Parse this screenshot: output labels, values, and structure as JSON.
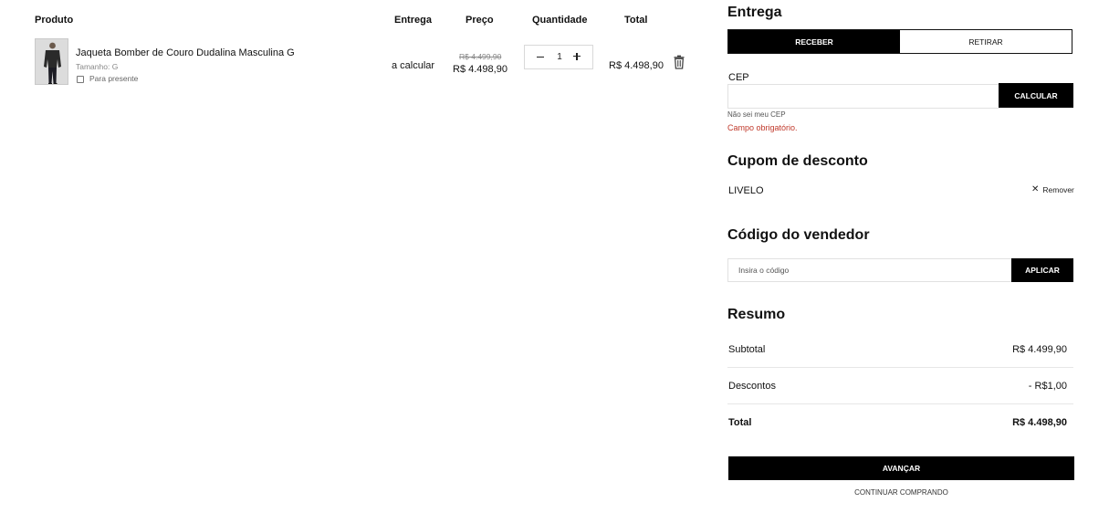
{
  "cart": {
    "headers": {
      "produto": "Produto",
      "entrega": "Entrega",
      "preco": "Preço",
      "quantidade": "Quantidade",
      "total": "Total"
    },
    "items": [
      {
        "image_icon": "product-photo-jacket",
        "name": "Jaqueta Bomber de Couro Dudalina Masculina G",
        "size": "Tamanho: G",
        "gift_label": "Para presente",
        "gift_checked": false,
        "shipping": "a calcular",
        "price_old": "R$ 4.499,90",
        "price_new": "R$ 4.498,90",
        "quantity": "1",
        "total": "R$ 4.498,90",
        "remove_icon": "trash-icon"
      }
    ]
  },
  "delivery": {
    "title": "Entrega",
    "tabs": [
      {
        "label": "RECEBER",
        "active": true
      },
      {
        "label": "RETIRAR",
        "active": false
      }
    ],
    "cep_label": "CEP",
    "cep_value": "",
    "calc_button": "CALCULAR",
    "unknown_cep_link": "Não sei meu CEP",
    "error": "Campo obrigatório."
  },
  "coupon": {
    "title": "Cupom de desconto",
    "code": "LIVELO",
    "remove_label": "Remover",
    "remove_icon": "close-icon"
  },
  "seller": {
    "title": "Código do vendedor",
    "placeholder": "Insira o código",
    "apply_button": "APLICAR"
  },
  "summary": {
    "title": "Resumo",
    "rows": [
      {
        "label": "Subtotal",
        "value": "R$ 4.499,90"
      },
      {
        "label": "Descontos",
        "value": "- R$1,00"
      },
      {
        "label": "Total",
        "value": "R$ 4.498,90"
      }
    ],
    "advance_button": "AVANÇAR",
    "continue_link": "CONTINUAR COMPRANDO"
  },
  "colors": {
    "primary": "#000000",
    "error": "#c0392b",
    "muted": "#888888",
    "border": "#e1e1e1"
  }
}
